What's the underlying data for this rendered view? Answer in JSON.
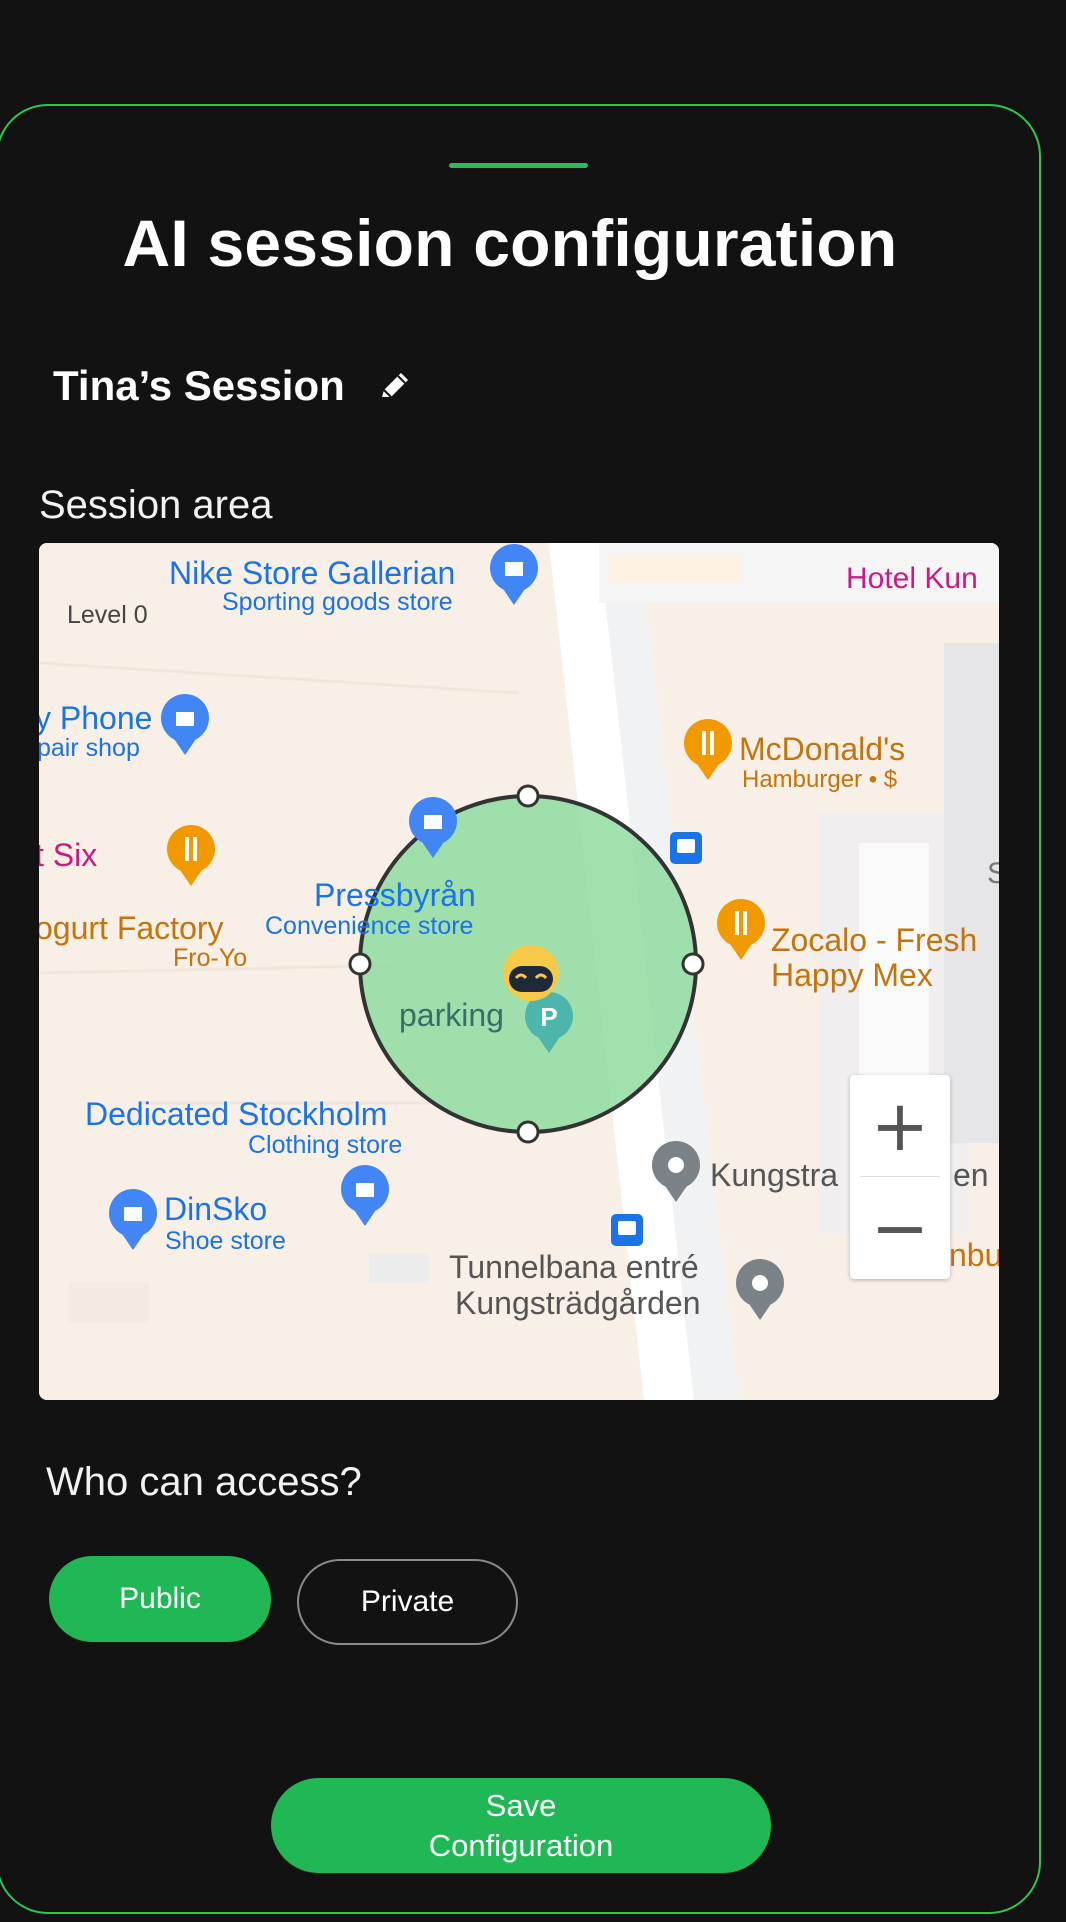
{
  "page": {
    "title": "AI session configuration"
  },
  "session": {
    "name": "Tina’s Session"
  },
  "session_area": {
    "label": "Session area",
    "map": {
      "places": [
        {
          "name": "Nike Store Gallerian",
          "sub": "Sporting goods store"
        },
        {
          "name": "Level 0"
        },
        {
          "name": "Hotel Kun"
        },
        {
          "name": "y Phone",
          "sub": "pair shop"
        },
        {
          "name": "McDonald's",
          "sub": "Hamburger • $"
        },
        {
          "name": "t Six"
        },
        {
          "name": "Pressbyrån",
          "sub": "Convenience store"
        },
        {
          "name": "ogurt Factory",
          "sub": "Fro-Yo"
        },
        {
          "name": "Zocalo - Fresh",
          "sub": "Happy Mex"
        },
        {
          "name": "parking"
        },
        {
          "name": "Dedicated Stockholm",
          "sub": "Clothing store"
        },
        {
          "name": "Kungstra",
          "sub": "en i"
        },
        {
          "name": "DinSko",
          "sub": "Shoe store"
        },
        {
          "name": "Tunnelbana entré",
          "sub": "Kungsträdgården"
        },
        {
          "name": "nbu"
        },
        {
          "name": "S"
        }
      ],
      "zoom_in": "+",
      "zoom_out": "−"
    }
  },
  "access": {
    "label": "Who can access?",
    "options": [
      {
        "label": "Public",
        "selected": true
      },
      {
        "label": "Private",
        "selected": false
      }
    ]
  },
  "save_button": {
    "label": "Save\nConfiguration"
  },
  "colors": {
    "accent": "#1fb855",
    "border": "#2bc653",
    "background": "#121212",
    "circle_fill": "#8fdca0"
  },
  "icons": {
    "edit": "pencil-icon",
    "avatar": "robot-avatar-icon"
  }
}
